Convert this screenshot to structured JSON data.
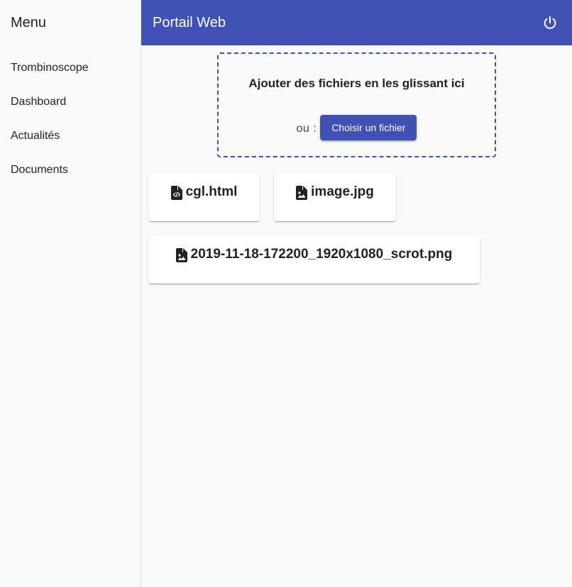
{
  "sidebar": {
    "title": "Menu",
    "items": [
      {
        "label": "Trombinoscope"
      },
      {
        "label": "Dashboard"
      },
      {
        "label": "Actualités"
      },
      {
        "label": "Documents"
      }
    ]
  },
  "toolbar": {
    "title": "Portail Web",
    "power_icon": "power-icon"
  },
  "dropzone": {
    "title": "Ajouter des fichiers en les glissant ici",
    "or_label": "ou :",
    "button_label": "Choisir un fichier"
  },
  "files": [
    {
      "name": "cgl.html",
      "icon": "file-code-icon"
    },
    {
      "name": "image.jpg",
      "icon": "file-image-icon"
    },
    {
      "name": "2019-11-18-172200_1920x1080_scrot.png",
      "icon": "file-image-icon"
    }
  ],
  "colors": {
    "primary": "#3f51b5",
    "background": "#fafafa"
  }
}
